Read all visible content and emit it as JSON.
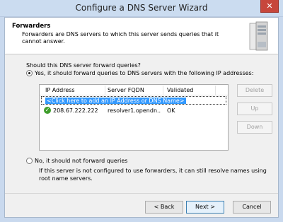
{
  "window": {
    "title": "Configure a DNS Server Wizard",
    "close_glyph": "✕"
  },
  "header": {
    "title": "Forwarders",
    "description": "Forwarders are DNS servers to which this server sends queries that it cannot answer."
  },
  "question": "Should this DNS server forward queries?",
  "option_yes": {
    "label": "Yes, it should forward queries to DNS servers with the following IP addresses:",
    "selected": true
  },
  "list": {
    "columns": [
      "IP Address",
      "Server FQDN",
      "Validated"
    ],
    "add_prompt": "<Click here to add an IP Address or DNS Name>",
    "rows": [
      {
        "status_icon": "check-circle-icon",
        "ip": "208.67.222.222",
        "fqdn": "resolver1.opendn...",
        "validated": "OK"
      }
    ]
  },
  "side_buttons": {
    "delete": "Delete",
    "up": "Up",
    "down": "Down"
  },
  "option_no": {
    "label": "No, it should not forward queries",
    "selected": false
  },
  "note": "If this server is not configured to use forwarders, it can still resolve names using root name servers.",
  "footer": {
    "back": "< Back",
    "next": "Next >",
    "cancel": "Cancel"
  },
  "colors": {
    "title_bar": "#cbdcf0",
    "close_button": "#c7463b",
    "selection": "#3399ff",
    "ok_green": "#3f9e2c"
  }
}
